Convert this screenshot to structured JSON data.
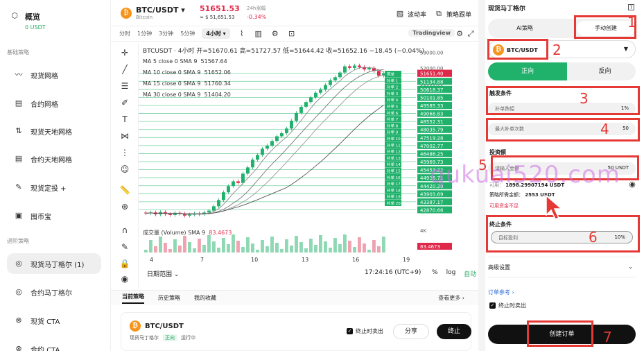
{
  "sidebar": {
    "overview": {
      "title": "概览",
      "value": "0 USDT"
    },
    "sections": [
      "基础策略",
      "进阶策略"
    ],
    "items": [
      {
        "label": "现货网格"
      },
      {
        "label": "合约网格"
      },
      {
        "label": "现货天地网格"
      },
      {
        "label": "合约天地网格"
      },
      {
        "label": "现货定投 +"
      },
      {
        "label": "囤币宝"
      },
      {
        "label": "现货马丁格尔 (1)"
      },
      {
        "label": "合约马丁格尔"
      },
      {
        "label": "现货 CTA"
      },
      {
        "label": "合约 CTA"
      }
    ]
  },
  "header": {
    "pair": "BTC/USDT",
    "pair_sub": "Bitcoin",
    "price": "51651.53",
    "price_usd": "≈ $ 51,651.53",
    "change_label": "24h涨幅",
    "change_value": "-0.34%",
    "buttons": [
      "波动率",
      "策略跟单"
    ]
  },
  "timeframes": {
    "items": [
      "分时",
      "1分钟",
      "3分钟",
      "5分钟",
      "4小时 ▾"
    ],
    "tv_label": "Tradingview"
  },
  "chart_legend": {
    "ohlc": "BTCUSDT · 4小时  开=51670.61 高=51727.57 低=51644.42 收=51652.16 −18.45 (−0.04%)",
    "ma": [
      {
        "label": "MA 5 close 0 SMA 9",
        "value": "51567.64"
      },
      {
        "label": "MA 10 close 0 SMA 9",
        "value": "51652.06"
      },
      {
        "label": "MA 15 close 0 SMA 9",
        "value": "51760.34"
      },
      {
        "label": "MA 30 close 0 SMA 9",
        "value": "51404.20"
      }
    ],
    "volume": "成交量 (Volume) SMA 9",
    "volume_value": "83.4673"
  },
  "chart_data": {
    "type": "candlestick",
    "x_ticks": [
      "4",
      "7",
      "10",
      "13",
      "16",
      "19"
    ],
    "y_ticks": [
      "53000.00",
      "52000.00",
      "51000.00",
      "50000.00",
      "49000.00",
      "48000.00",
      "47000.00",
      "46000.00",
      "45000.00",
      "44000.00",
      "43000.00"
    ],
    "grid_labels": [
      "51652.16",
      "51134.88",
      "50618.37",
      "50101.85",
      "49585.33",
      "49068.83",
      "48552.31",
      "48035.79",
      "47519.28",
      "47002.77",
      "46486.25",
      "45969.73",
      "45453.22",
      "44936.71",
      "44420.20",
      "43903.69",
      "43387.17",
      "42870.66"
    ],
    "order_labels": [
      "首单",
      "补单 1",
      "补单 2",
      "补单 3",
      "补单 4",
      "补单 5",
      "补单 6",
      "补单 7",
      "补单 8",
      "补单 9",
      "补单 10",
      "补单 11",
      "补单 12",
      "补单 13",
      "补单 14",
      "补单 15",
      "补单 16",
      "补单 17",
      "补单 18",
      "补单 19",
      "补单 20"
    ],
    "current_price_label": "51651.40",
    "volume_axis_label": "4K",
    "volume_current_label": "83.4673",
    "close": [
      42650,
      42700,
      42580,
      42720,
      42600,
      42540,
      42680,
      42620,
      42500,
      42560,
      42640,
      42590,
      42700,
      42820,
      43100,
      43500,
      44000,
      44400,
      44700,
      44600,
      45200,
      45600,
      46100,
      46400,
      46800,
      47000,
      47300,
      47600,
      47800,
      48100,
      48600,
      49100,
      49500,
      49800,
      50100,
      50400,
      50600,
      50900,
      51200,
      51400,
      51700,
      52100,
      52000,
      52150,
      52050,
      51900,
      52000,
      51800,
      51500,
      51650
    ]
  },
  "chart_footer": {
    "range": "日期范围 ⌄",
    "time": "17:24:16 (UTC+9)",
    "pct": "%",
    "log": "log",
    "auto": "自动"
  },
  "bottom_tabs": {
    "items": [
      "当前策略",
      "历史策略",
      "我的收藏"
    ],
    "more": "查看更多 ›"
  },
  "strategy_card": {
    "pair": "BTC/USDT",
    "type": "现货马丁格尔",
    "tag": "正向",
    "status": "运行中",
    "stop_sell": "终止时卖出",
    "share": "分享",
    "stop": "终止"
  },
  "right_panel": {
    "title": "现货马丁格尔",
    "mode": {
      "ai": "AI策略",
      "manual": "手动创建"
    },
    "pair": "BTC/USDT",
    "direction": {
      "long": "正向",
      "short": "反向"
    },
    "trigger_title": "触发条件",
    "trigger_field": {
      "label": "补单跌幅",
      "value": "1%"
    },
    "max_orders": {
      "label": "最大补单次数",
      "value": "50"
    },
    "invest_title": "投资额",
    "invest_field": {
      "label": "请输入金额",
      "value": "50 USDT"
    },
    "available_label": "可用：",
    "available_value": "1898.29907194 USDT",
    "required_label": "策略所需金额：",
    "required_value": "2553 USDT",
    "insufficient": "可用资金不足",
    "stop_title": "终止条件",
    "stop_field": {
      "label": "目标盈利",
      "value": "10%"
    },
    "advanced": "高级设置",
    "order_ref": "订单参考 ›",
    "stop_sell": "终止时卖出",
    "create": "创建订单"
  },
  "annotations": [
    "1",
    "2",
    "3",
    "4",
    "5",
    "6",
    "7"
  ],
  "watermark": "qukuai520.com",
  "colors": {
    "up": "#20b16b",
    "down": "#e0294a",
    "annotation": "#e53935",
    "watermark": "#cd6ee6"
  }
}
